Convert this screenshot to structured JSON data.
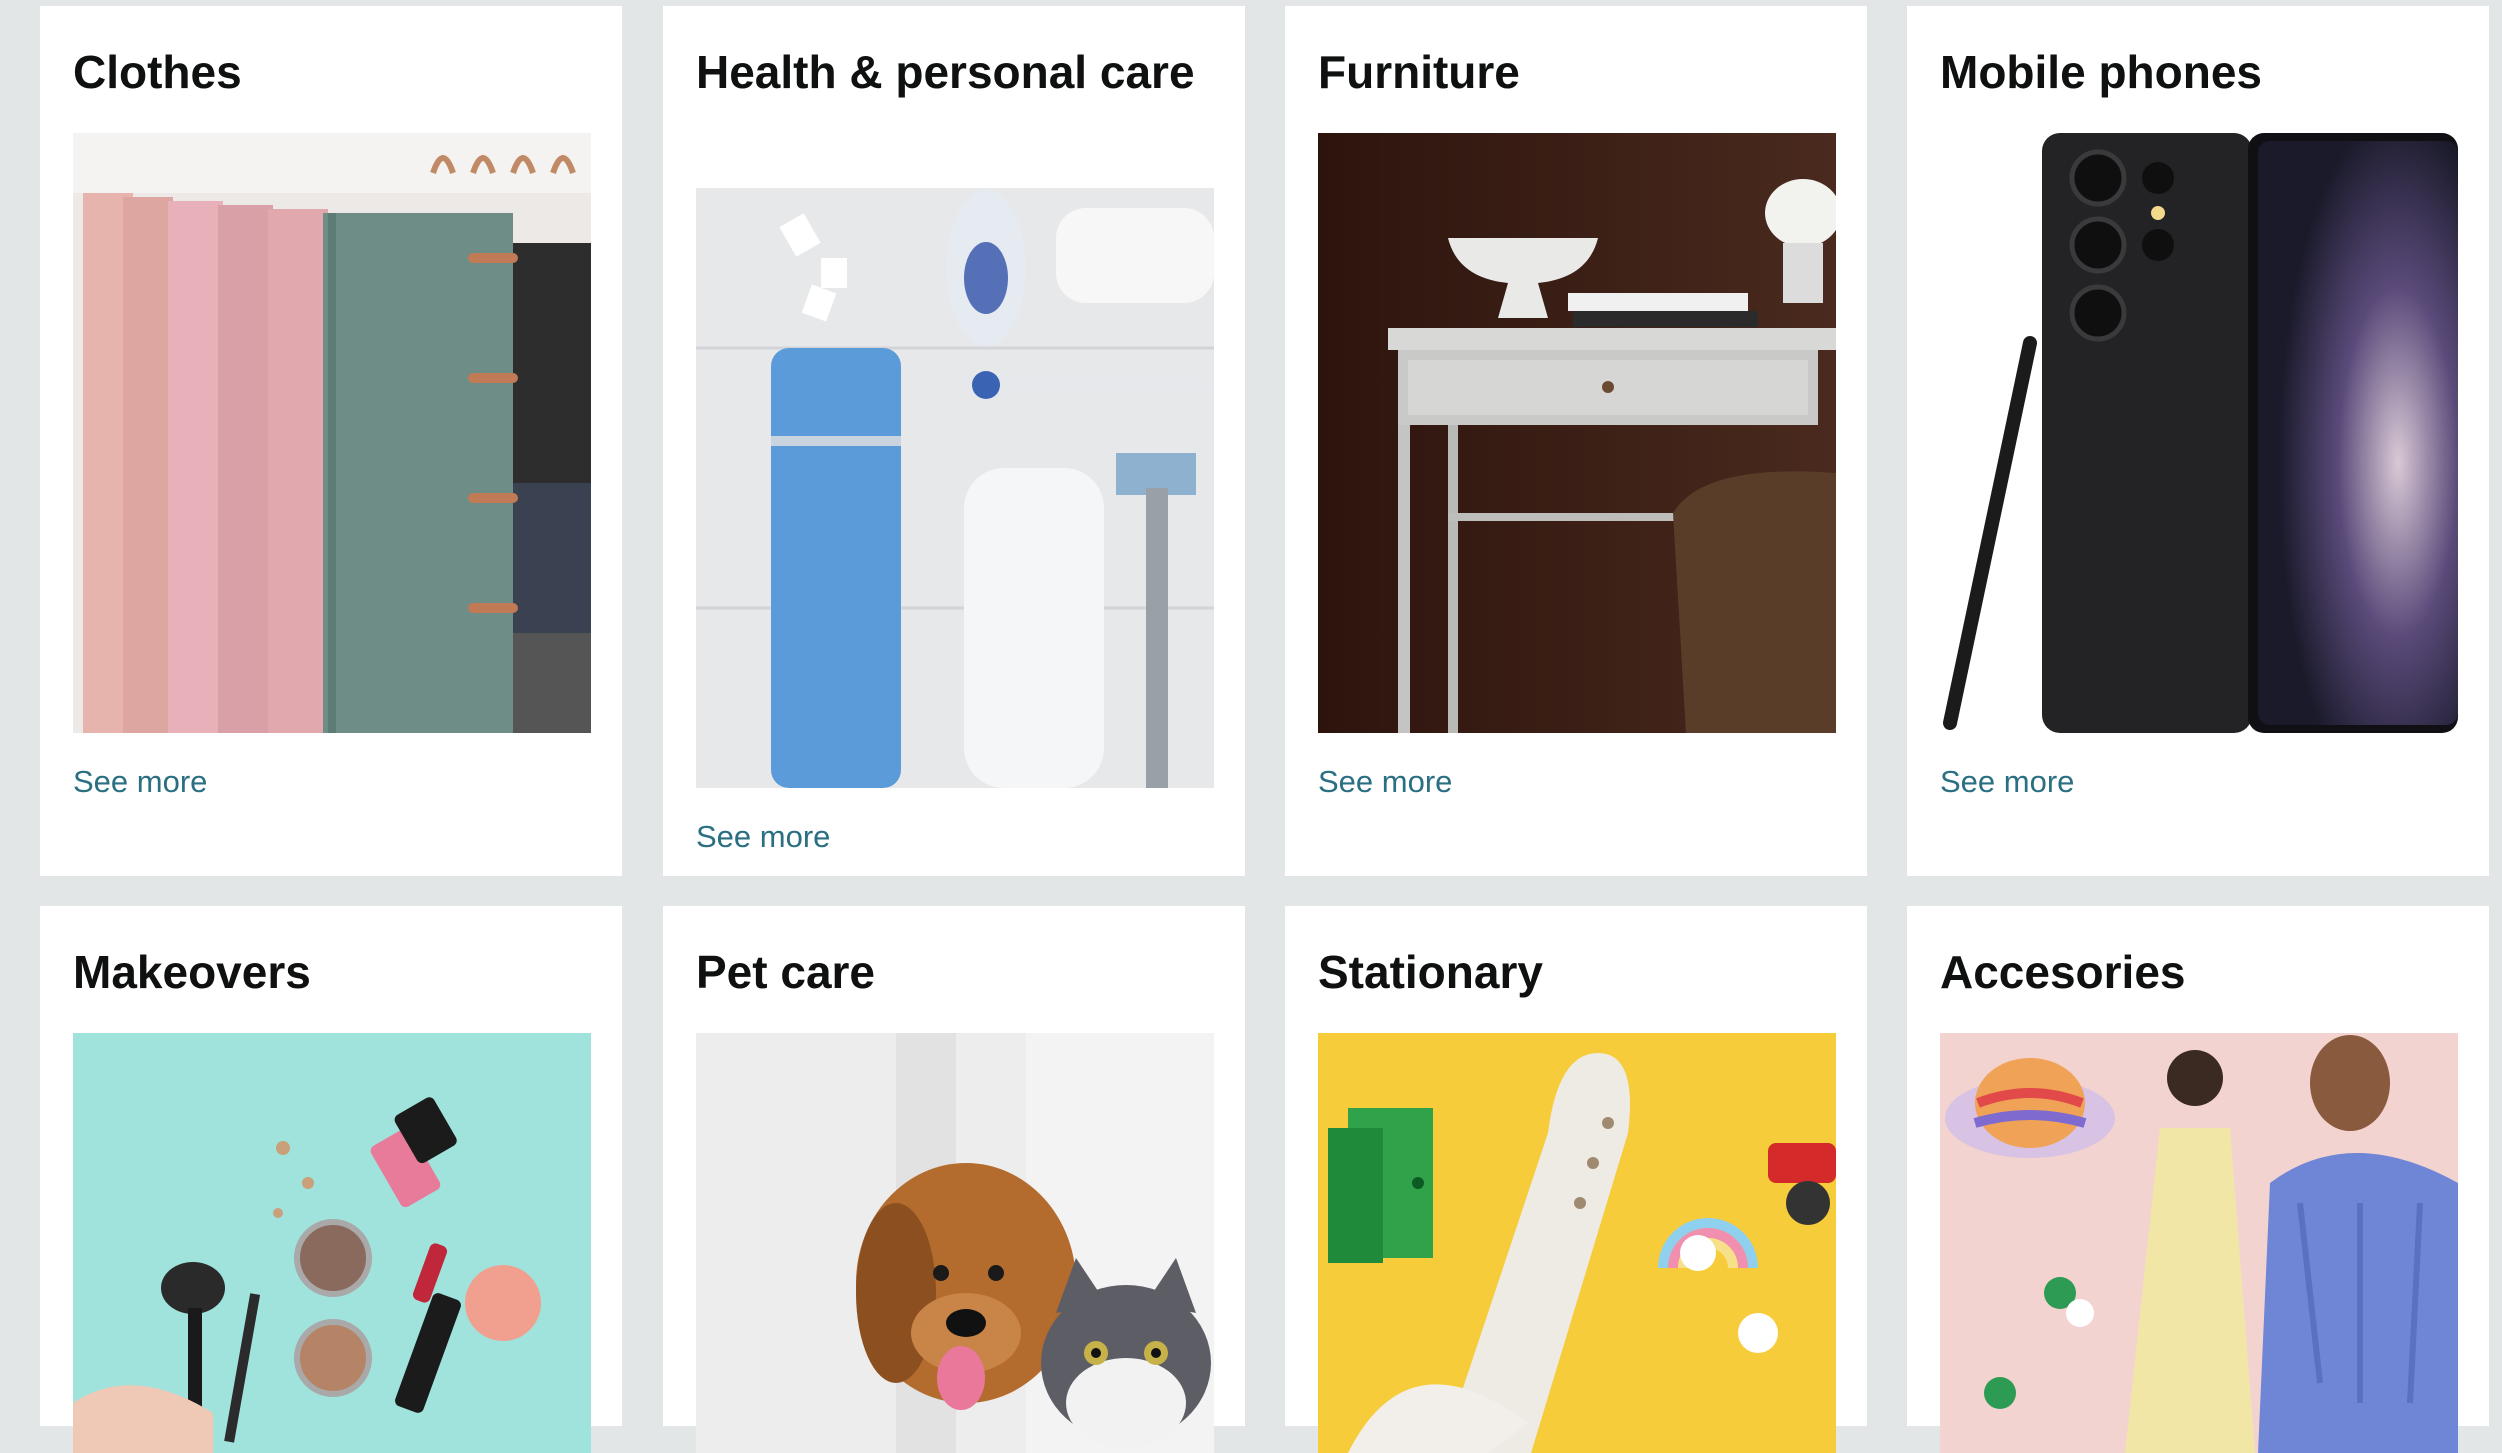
{
  "cards": [
    {
      "title": "Clothes",
      "link": "See more",
      "image": "folded-scarves-on-hanger"
    },
    {
      "title": "Health & personal care",
      "link": "See more",
      "image": "toiletries-flat-lay"
    },
    {
      "title": "Furniture",
      "link": "See more",
      "image": "grey-desk-with-bowl"
    },
    {
      "title": "Mobile phones",
      "link": "See more",
      "image": "smartphone-with-stylus"
    },
    {
      "title": "Makeovers",
      "image": "makeup-products"
    },
    {
      "title": "Pet care",
      "image": "dog-and-cat"
    },
    {
      "title": "Stationary",
      "image": "toy-airplane-on-yellow"
    },
    {
      "title": "Accesories",
      "image": "hat-and-dresses"
    }
  ],
  "colors": {
    "page_bg": "#e3e6e6",
    "card_bg": "#ffffff",
    "link": "#2a6f82",
    "title": "#0f1111"
  }
}
